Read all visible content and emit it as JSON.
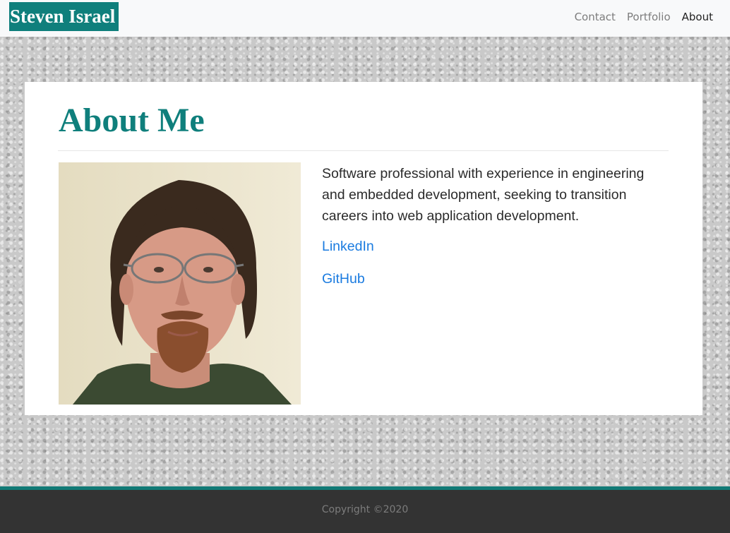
{
  "brand": "Steven Israel",
  "nav": {
    "contact": "Contact",
    "portfolio": "Portfolio",
    "about": "About"
  },
  "about": {
    "title": "About Me",
    "bio": "Software professional with experience in engineering and embedded development, seeking to transition careers into web application development.",
    "linkedin": "LinkedIn",
    "github": "GitHub"
  },
  "footer": {
    "copyright": "Copyright ©2020"
  },
  "colors": {
    "accent": "#0f7f7c",
    "link": "#1a7be0",
    "footer_bg": "#333333"
  }
}
